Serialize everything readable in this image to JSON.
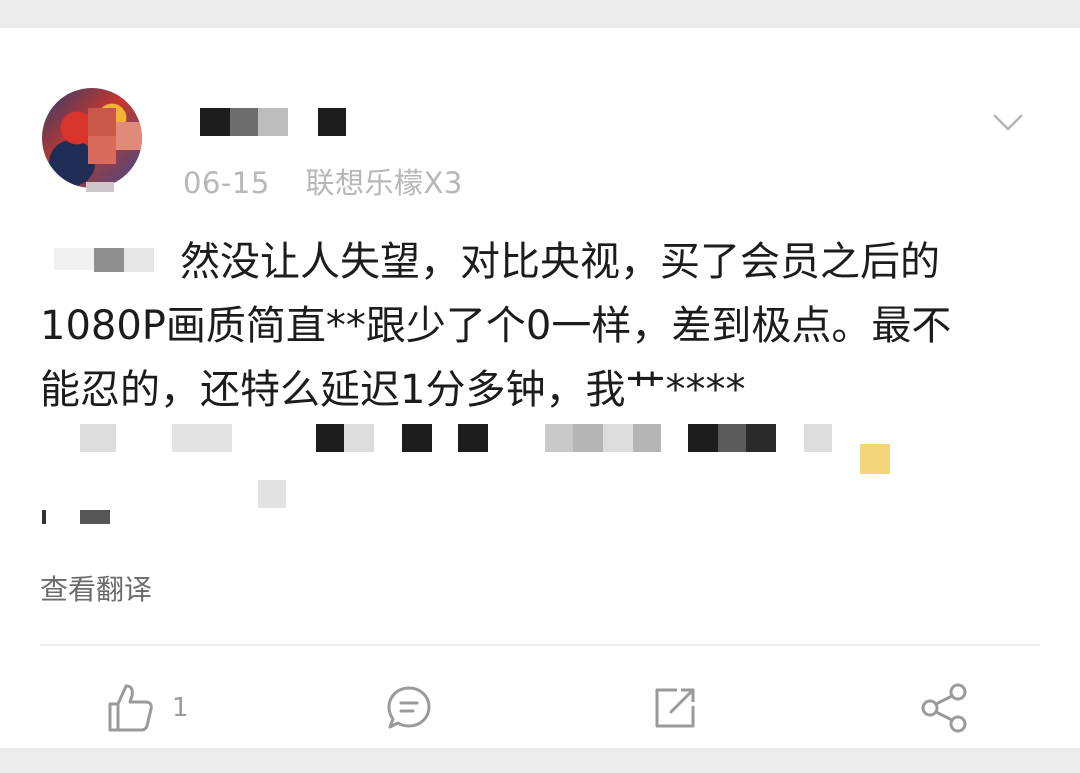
{
  "post": {
    "date": "06-15",
    "device": "联想乐檬X3",
    "text_line1": "然没让人失望，对比央视，买了会员之后的",
    "text_line2": "1080P画质简直**跟少了个0一样，差到极点。最不",
    "text_line3": "能忍的，还特么延迟1分多钟，我艹****",
    "translate_label": "查看翻译"
  },
  "actions": {
    "like_count": "1",
    "like_icon": "thumbs-up-icon",
    "comment_icon": "comment-icon",
    "repost_icon": "repost-icon",
    "share_icon": "share-icon"
  },
  "colors": {
    "background": "#ececec",
    "card": "#ffffff",
    "text": "#1c1c1c",
    "meta": "#b7b7b7",
    "icon": "#9a9a9a"
  }
}
